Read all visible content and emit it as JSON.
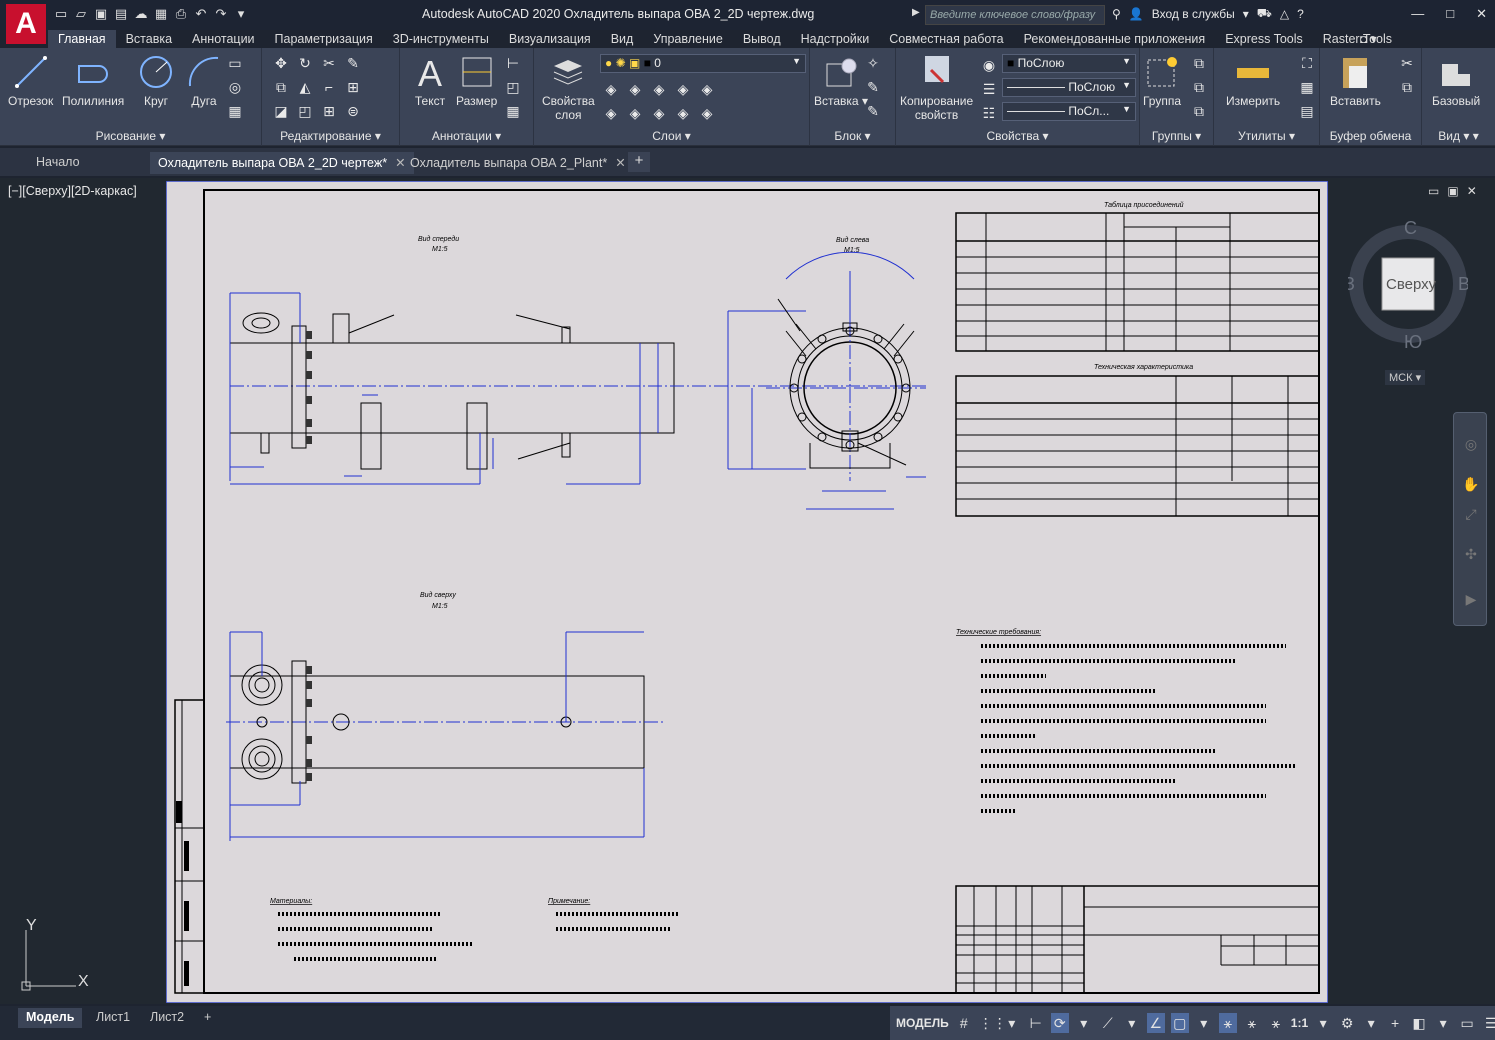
{
  "app": {
    "logo_letter": "A",
    "title": "Autodesk AutoCAD 2020    Охладитель выпара ОВА 2_2D чертеж.dwg",
    "search_placeholder": "Введите ключевое слово/фразу",
    "sign_in": "Вход в службы",
    "window_controls": [
      "—",
      "□",
      "✕"
    ]
  },
  "quick_access": [
    "new-icon",
    "open-icon",
    "save-icon",
    "save-as-icon",
    "cloud-icon",
    "web-icon",
    "print-icon",
    "undo-icon",
    "redo-icon",
    "share-icon"
  ],
  "ribbon": {
    "tabs": [
      "Главная",
      "Вставка",
      "Аннотации",
      "Параметризация",
      "3D-инструменты",
      "Визуализация",
      "Вид",
      "Управление",
      "Вывод",
      "Надстройки",
      "Совместная работа",
      "Рекомендованные приложения",
      "Express Tools",
      "Raster Tools"
    ],
    "active_tab": 0,
    "panels": {
      "draw": {
        "title": "Рисование",
        "buttons": [
          "Отрезок",
          "Полилиния",
          "Круг",
          "Дуга"
        ]
      },
      "modify": {
        "title": "Редактирование"
      },
      "annotation": {
        "title": "Аннотации",
        "buttons": [
          "Текст",
          "Размер"
        ]
      },
      "layers": {
        "title": "Слои",
        "props_button": "Свойства\nслоя",
        "current_layer": "0"
      },
      "block": {
        "title": "Блок",
        "insert_button": "Вставка"
      },
      "properties": {
        "title": "Свойства",
        "match_button": "Копирование\nсвойств",
        "color": "ПоСлою",
        "linetype": "ПоСлою",
        "lineweight": "ПоСл..."
      },
      "groups": {
        "title": "Группы",
        "group_button": "Группа"
      },
      "utilities": {
        "title": "Утилиты",
        "measure_button": "Измерить"
      },
      "clipboard": {
        "title": "Буфер обмена",
        "paste_button": "Вставить"
      },
      "view": {
        "title": "Вид",
        "base_button": "Базовый"
      }
    }
  },
  "doc_tabs": [
    {
      "label": "Начало",
      "active": false
    },
    {
      "label": "Охладитель выпара ОВА 2_2D чертеж*",
      "active": true
    },
    {
      "label": "Охладитель выпара ОВА 2_Plant*",
      "active": false
    }
  ],
  "viewport": {
    "label": "[−][Сверху][2D-каркас]",
    "viewcube": {
      "face": "Сверху",
      "north": "С",
      "south": "Ю",
      "west": "З",
      "east": "В"
    },
    "wcs": "МСК",
    "ucs": {
      "x": "X",
      "y": "Y"
    }
  },
  "drawing": {
    "view1_title": "Вид спереди",
    "view1_scale": "М1:5",
    "view2_title": "Вид слева",
    "view2_scale": "М1:5",
    "view3_title": "Вид сверху",
    "view3_scale": "М1:5",
    "connections_table_title": "Таблица присоединений",
    "tech_table_title": "Техническая характеристика",
    "tech_req_title": "Технические требования:",
    "note1_title": "Материалы:",
    "note2_title": "Примечание:"
  },
  "layout_tabs": [
    "Модель",
    "Лист1",
    "Лист2"
  ],
  "status": {
    "mode": "МОДЕЛЬ",
    "scale": "1:1"
  }
}
